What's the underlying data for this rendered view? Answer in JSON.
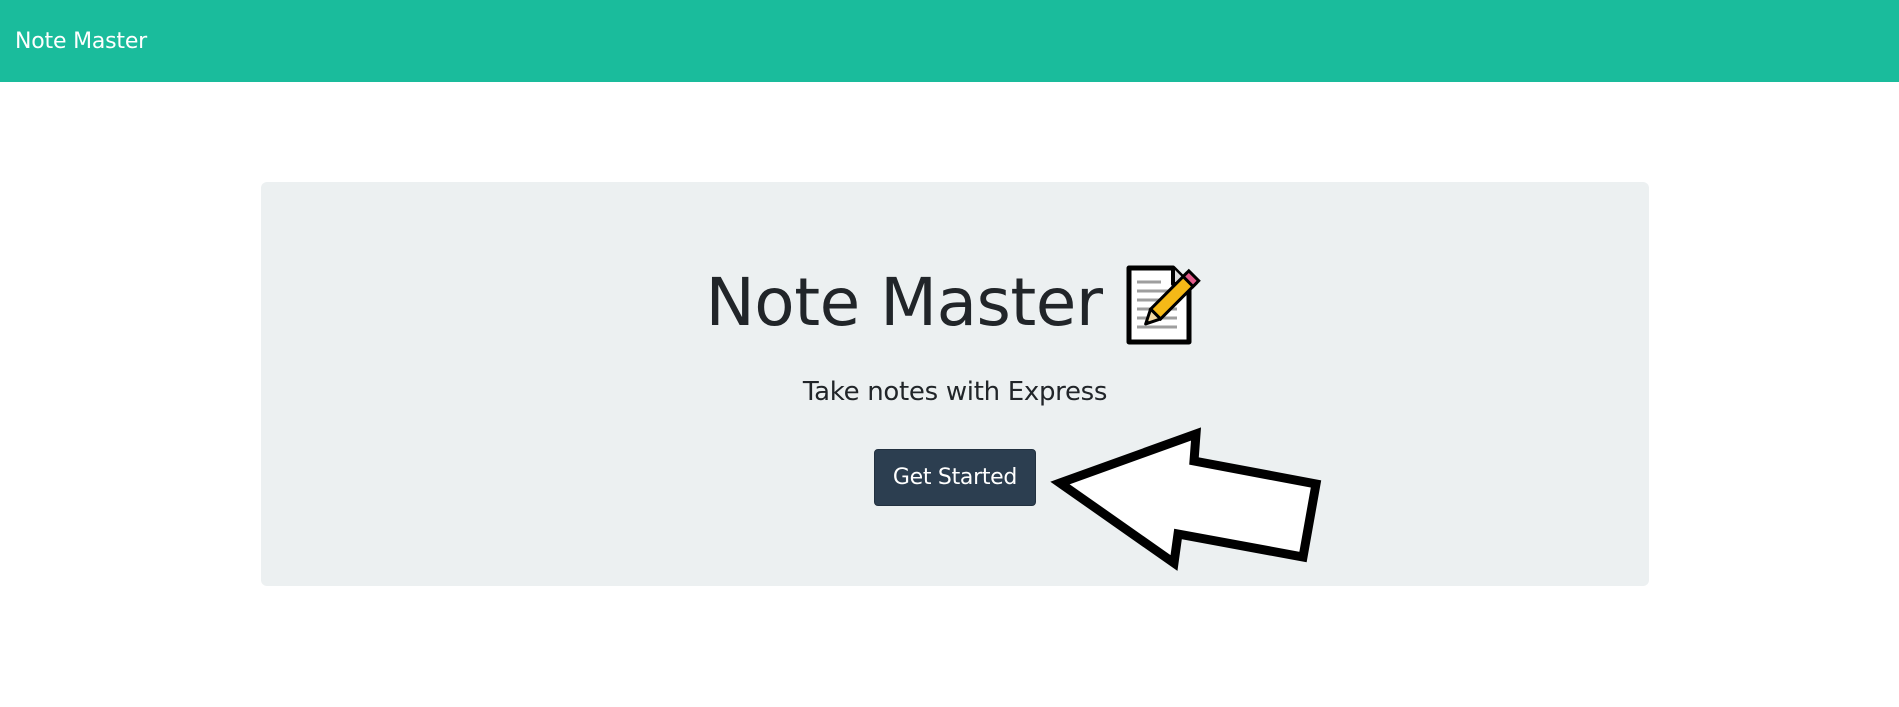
{
  "navbar": {
    "brand_label": "Note Master"
  },
  "hero": {
    "title": "Note Master",
    "title_icon": "memo-icon",
    "tagline": "Take notes with Express",
    "cta_label": "Get Started",
    "pointer_icon": "arrow-left-icon"
  },
  "colors": {
    "navbar_bg": "#1abc9c",
    "jumbotron_bg": "#ecf0f1",
    "button_bg": "#2c3e50",
    "text": "#212529"
  }
}
